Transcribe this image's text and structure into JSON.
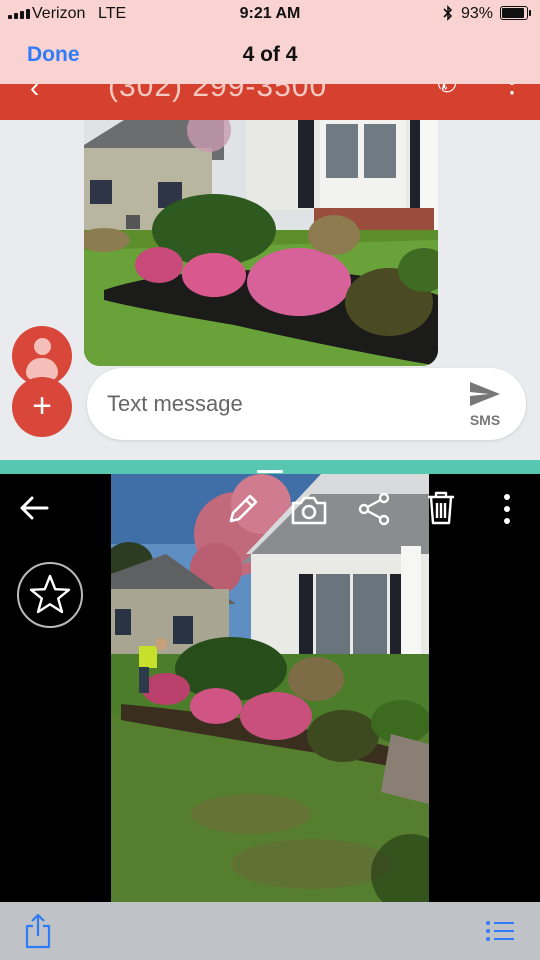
{
  "status_bar": {
    "carrier": "Verizon",
    "network": "LTE",
    "time": "9:21 AM",
    "battery_percent": "93%",
    "battery_level": 0.93
  },
  "nav": {
    "done_label": "Done",
    "page_counter": "4 of 4"
  },
  "app_bar": {
    "phone_number": "(302) 299-3500",
    "accent_color": "#d6412f"
  },
  "compose": {
    "placeholder": "Text message",
    "send_label": "SMS"
  },
  "colors": {
    "divider": "#57c7b2",
    "avatar": "#d9473a",
    "ios_link": "#2f7cf6"
  },
  "gallery_toolbar": {
    "icons": [
      "back-arrow-icon",
      "pencil-icon",
      "camera-icon",
      "share-icon",
      "trash-icon",
      "more-vertical-icon",
      "star-icon"
    ]
  },
  "ios_toolbar": {
    "icons": [
      "share-icon",
      "list-icon"
    ]
  }
}
